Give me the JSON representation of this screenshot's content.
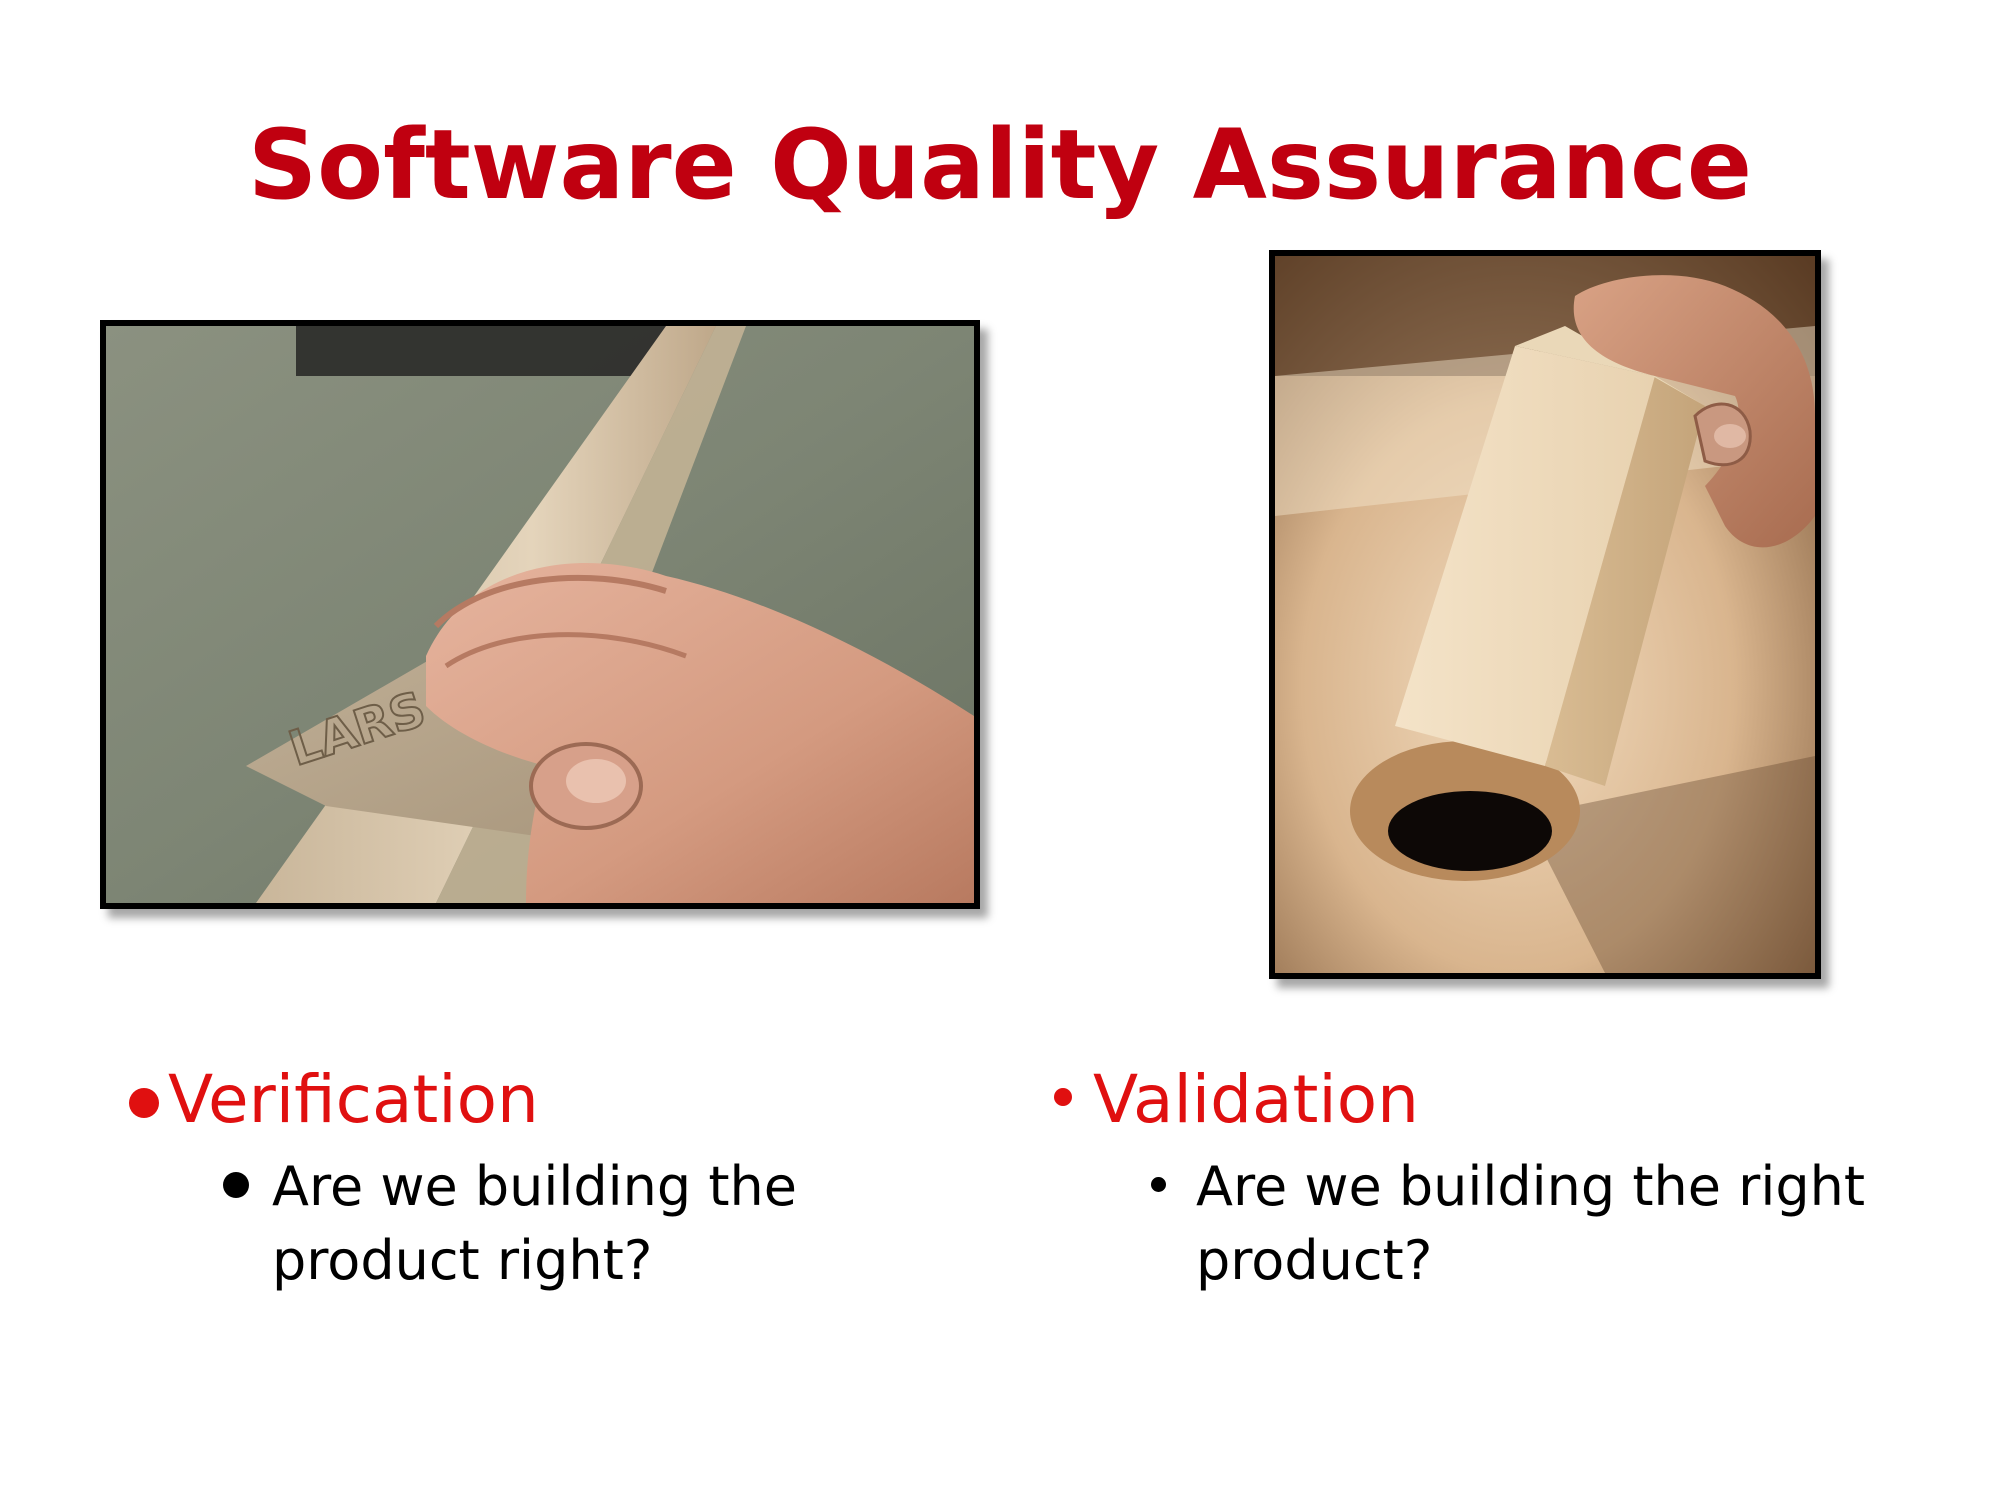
{
  "slide": {
    "title": "Software Quality Assurance",
    "accent_color": "#c00010",
    "bullet_color": "#e01010"
  },
  "left_column": {
    "image": {
      "icon": "photo-hand-sanding-wood-icon"
    },
    "heading": "Verification",
    "sub_line1": "Are we building the",
    "sub_line2": "product right?"
  },
  "right_column": {
    "image": {
      "icon": "photo-square-peg-round-hole-icon"
    },
    "heading": "Validation",
    "sub_line1": "Are we building the right",
    "sub_line2": "product?"
  }
}
